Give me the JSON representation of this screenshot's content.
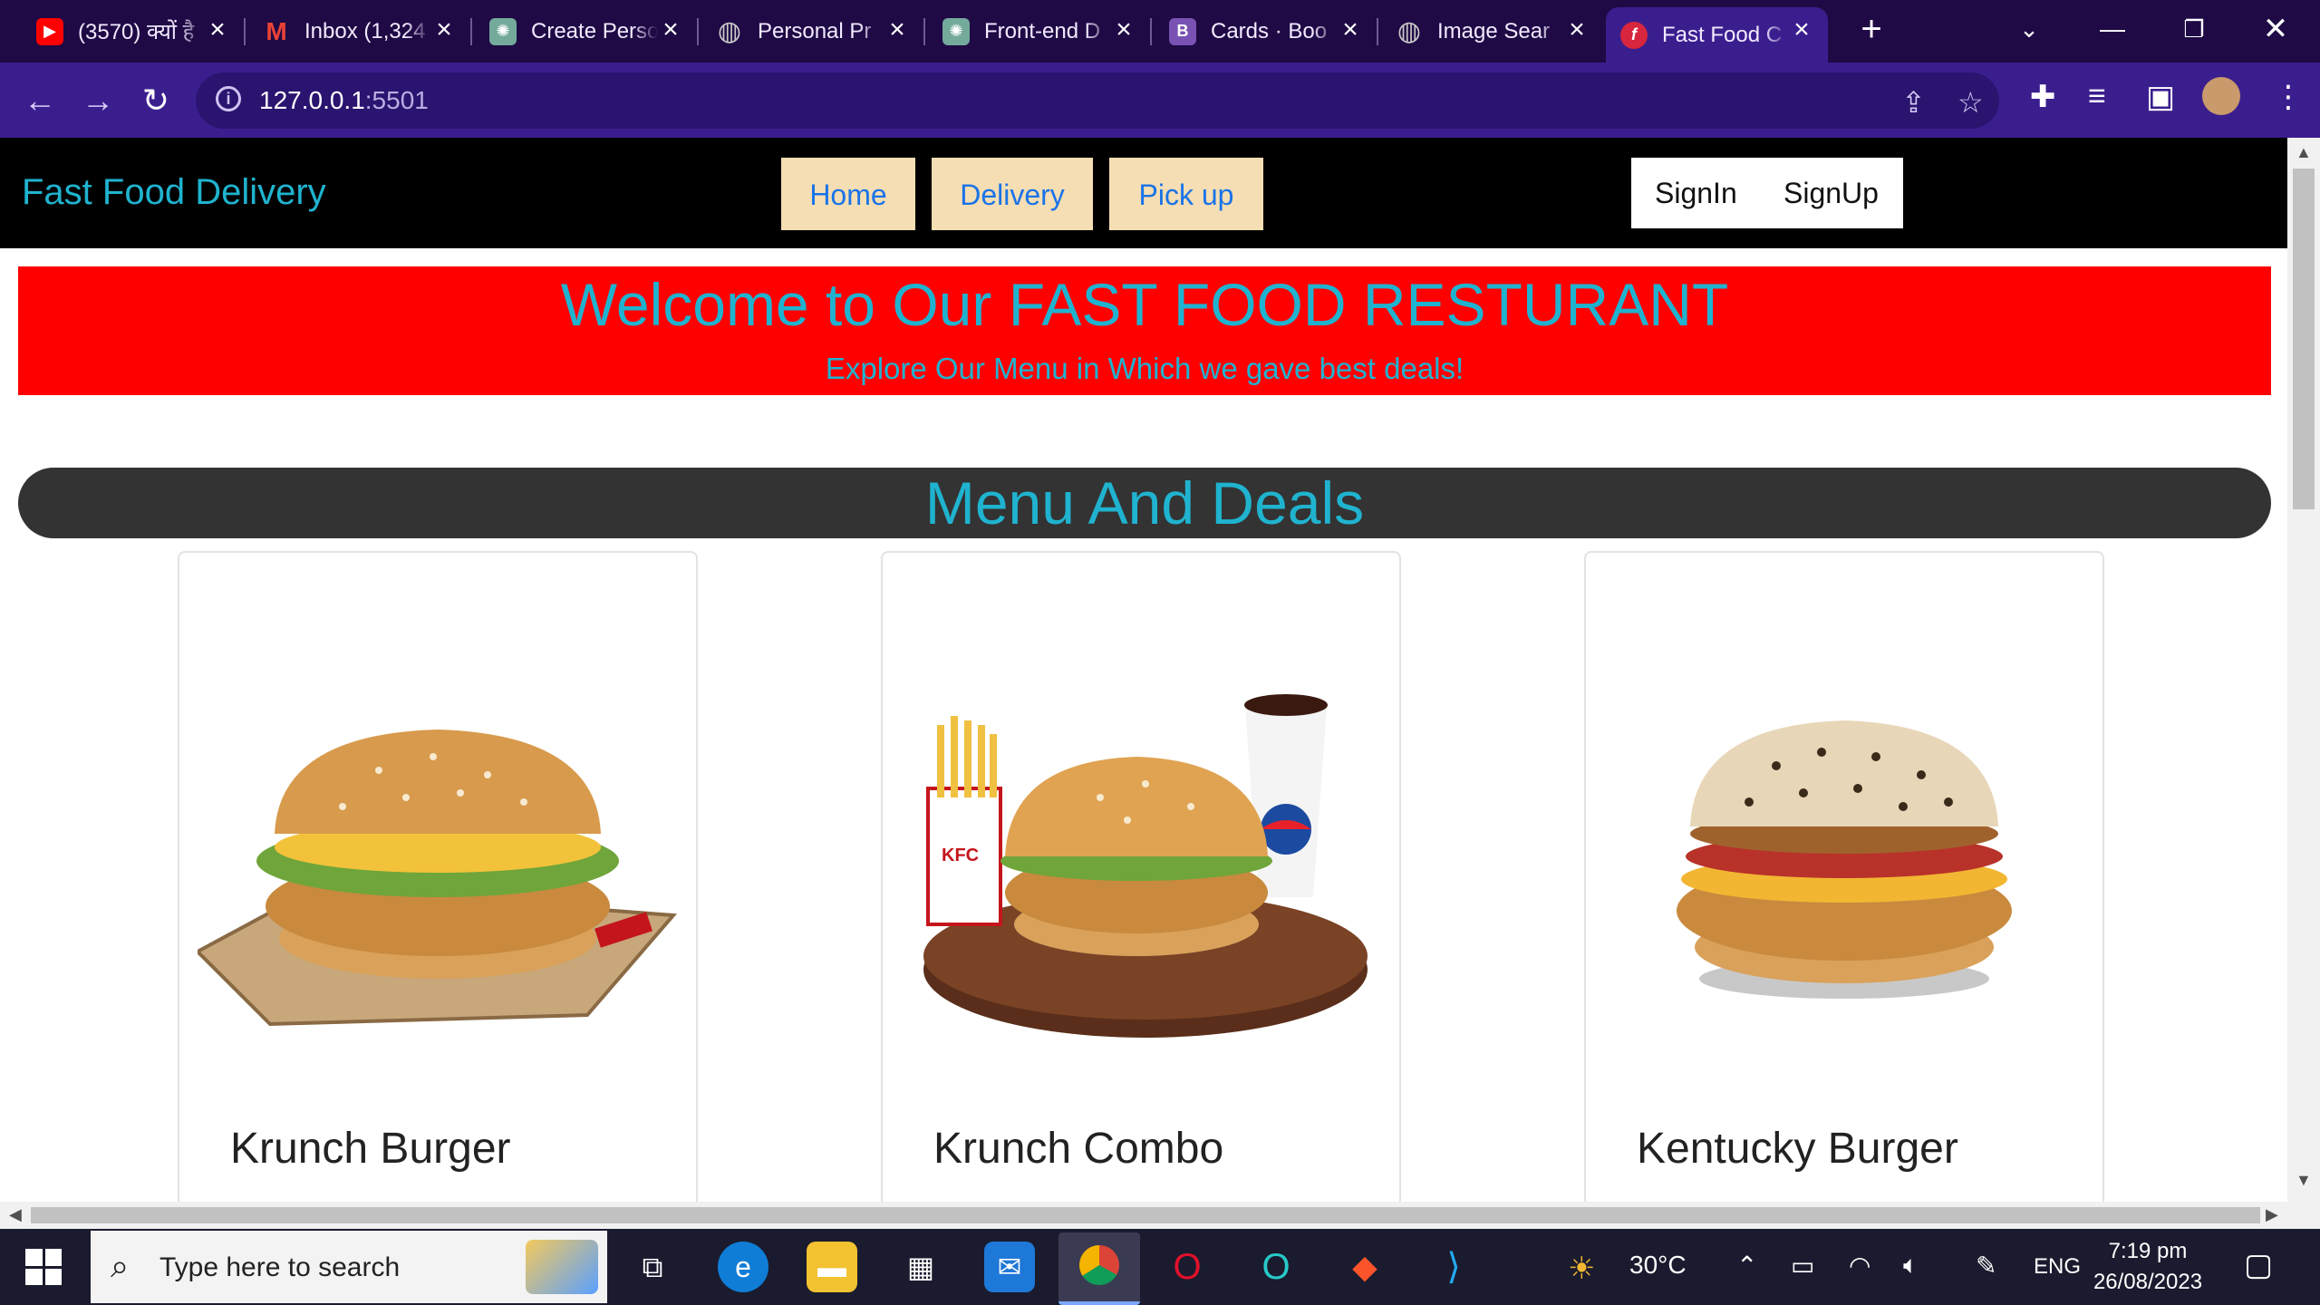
{
  "browser": {
    "tabs": [
      {
        "title": "(3570) क्यों है",
        "icon": "youtube-icon",
        "color": "#ff0000",
        "glyph": "▶"
      },
      {
        "title": "Inbox (1,324",
        "icon": "gmail-icon",
        "color": "#ea4335",
        "glyph": "M"
      },
      {
        "title": "Create Perso",
        "icon": "chatgpt-icon",
        "color": "#74aa9c",
        "glyph": "✺"
      },
      {
        "title": "Personal Pr",
        "icon": "globe-icon",
        "color": "#5f6368",
        "glyph": "◍"
      },
      {
        "title": "Front-end D",
        "icon": "chatgpt-icon",
        "color": "#74aa9c",
        "glyph": "✺"
      },
      {
        "title": "Cards · Boo",
        "icon": "bootstrap-icon",
        "color": "#7952b3",
        "glyph": "B"
      },
      {
        "title": "Image Sear",
        "icon": "globe-icon",
        "color": "#5f6368",
        "glyph": "◍"
      },
      {
        "title": "Fast Food C",
        "icon": "food-icon",
        "color": "#d7263d",
        "glyph": "f"
      }
    ],
    "url_host": "127.0.0.1",
    "url_port": ":5501"
  },
  "site": {
    "brand": "Fast Food Delivery",
    "nav": [
      "Home",
      "Delivery",
      "Pick up"
    ],
    "auth": {
      "signin": "SignIn",
      "signup": "SignUp"
    },
    "hero": {
      "title": "Welcome to Our FAST FOOD RESTURANT",
      "subtitle": "Explore Our Menu in Which we gave best deals!"
    },
    "section_title": "Menu And Deals",
    "cards": [
      {
        "name": "Krunch Burger",
        "image": "burger-on-kfc-paper-image"
      },
      {
        "name": "Krunch Combo",
        "image": "combo-fries-burger-pepsi-image"
      },
      {
        "name": "Kentucky Burger",
        "image": "kentucky-burger-image"
      }
    ],
    "colors": {
      "accent": "#1fb3cf",
      "hero_bg": "#ff0000",
      "nav_btn": "#f5deb3",
      "header_bg": "#000000"
    }
  },
  "taskbar": {
    "search_placeholder": "Type here to search",
    "weather": "30°C",
    "lang": "ENG",
    "time": "7:19 pm",
    "date": "26/08/2023"
  }
}
